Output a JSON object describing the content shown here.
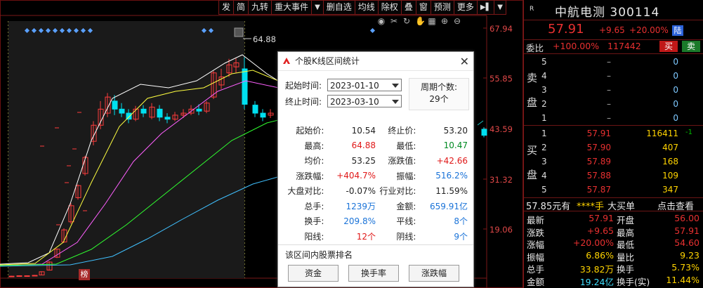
{
  "toolbar": [
    "发",
    "简",
    "九转",
    "重大事件",
    "删自选",
    "均线",
    "除权",
    "叠",
    "窗",
    "预测",
    "更多"
  ],
  "toolbar_arrow": "▼",
  "toolbar_nav": "▶▌",
  "toolbar_close": "▼",
  "chart_axis": {
    "labels": [
      "67.94",
      "55.85",
      "43.59",
      "31.32",
      "19.06"
    ],
    "high_marker": "64.88",
    "badge": "榜"
  },
  "colors": {
    "up": "#ff3c3c",
    "down": "#00e0f0",
    "bg": "#000000",
    "frame": "#7a1818"
  },
  "dialog": {
    "title": "个股K线区间统计",
    "start_label": "起始时间:",
    "start_value": "2023-01-10",
    "end_label": "终止时间:",
    "end_value": "2023-03-10",
    "period_label": "周期个数:",
    "period_value": "29个",
    "stats": [
      [
        {
          "k": "起始价:",
          "v": "10.54",
          "c": "blk"
        },
        {
          "k": "终止价:",
          "v": "53.20",
          "c": "blk"
        }
      ],
      [
        {
          "k": "最高:",
          "v": "64.88",
          "c": "red"
        },
        {
          "k": "最低:",
          "v": "10.47",
          "c": "green"
        }
      ],
      [
        {
          "k": "均价:",
          "v": "53.25",
          "c": "blk"
        },
        {
          "k": "涨跌值:",
          "v": "+42.66",
          "c": "red"
        }
      ],
      [
        {
          "k": "涨跌幅:",
          "v": "+404.7%",
          "c": "red"
        },
        {
          "k": "振幅:",
          "v": "516.2%",
          "c": "blue"
        }
      ],
      [
        {
          "k": "大盘对比:",
          "v": "-0.07%",
          "c": "blk"
        },
        {
          "k": "行业对比:",
          "v": "11.59%",
          "c": "blk"
        }
      ],
      [
        {
          "k": "总手:",
          "v": "1239万",
          "c": "blue"
        },
        {
          "k": "金额:",
          "v": "659.91亿",
          "c": "blue"
        }
      ],
      [
        {
          "k": "换手:",
          "v": "209.8%",
          "c": "blue"
        },
        {
          "k": "平线:",
          "v": "8个",
          "c": "blue"
        }
      ],
      [
        {
          "k": "阳线:",
          "v": "12个",
          "c": "red"
        },
        {
          "k": "阴线:",
          "v": "9个",
          "c": "blue"
        }
      ]
    ],
    "rank_title": "该区间内股票排名",
    "rank_buttons": [
      "资金",
      "换手率",
      "涨跌幅"
    ],
    "close": "✕"
  },
  "panel": {
    "r_mark": "R",
    "name": "中航电测 300114",
    "price": "57.91",
    "change": "+9.65",
    "pct": "+20.00%",
    "lu_badge": "陆",
    "weibi_label": "委比",
    "weibi_value": "+100.00%",
    "weicha_value": "117442",
    "buy_btn": "买",
    "sell_btn": "卖",
    "sell_label": [
      "卖",
      "盘"
    ],
    "buy_label": [
      "买",
      "盘"
    ],
    "sells": [
      {
        "n": "5",
        "p": "–",
        "v": "0"
      },
      {
        "n": "4",
        "p": "–",
        "v": "0"
      },
      {
        "n": "3",
        "p": "–",
        "v": "0"
      },
      {
        "n": "2",
        "p": "–",
        "v": "0"
      },
      {
        "n": "1",
        "p": "–",
        "v": "0"
      }
    ],
    "buys": [
      {
        "n": "1",
        "p": "57.91",
        "v": "116411",
        "e": "-1"
      },
      {
        "n": "2",
        "p": "57.90",
        "v": "407",
        "e": ""
      },
      {
        "n": "3",
        "p": "57.89",
        "v": "168",
        "e": ""
      },
      {
        "n": "4",
        "p": "57.88",
        "v": "109",
        "e": ""
      },
      {
        "n": "5",
        "p": "57.87",
        "v": "347",
        "e": ""
      }
    ],
    "summary": {
      "a": "57.85元有",
      "b": "****手",
      "c": "大买单",
      "d": "点击查看"
    },
    "quotes": [
      {
        "k1": "最新",
        "v1": "57.91",
        "c1": "rd",
        "k2": "开盘",
        "v2": "56.00",
        "c2": "rd"
      },
      {
        "k1": "涨跌",
        "v1": "+9.65",
        "c1": "rd",
        "k2": "最高",
        "v2": "57.91",
        "c2": "rd"
      },
      {
        "k1": "涨幅",
        "v1": "+20.00%",
        "c1": "rd",
        "k2": "最低",
        "v2": "54.60",
        "c2": "rd"
      },
      {
        "k1": "振幅",
        "v1": "6.86%",
        "c1": "yel",
        "k2": "量比",
        "v2": "9.23",
        "c2": "yel"
      },
      {
        "k1": "总手",
        "v1": "33.82万",
        "c1": "yel",
        "k2": "换手",
        "v2": "5.73%",
        "c2": "yel"
      },
      {
        "k1": "金额",
        "v1": "19.24亿",
        "c1": "cy",
        "k2": "换手(实)",
        "v2": "11.44%",
        "c2": "yel"
      }
    ]
  }
}
